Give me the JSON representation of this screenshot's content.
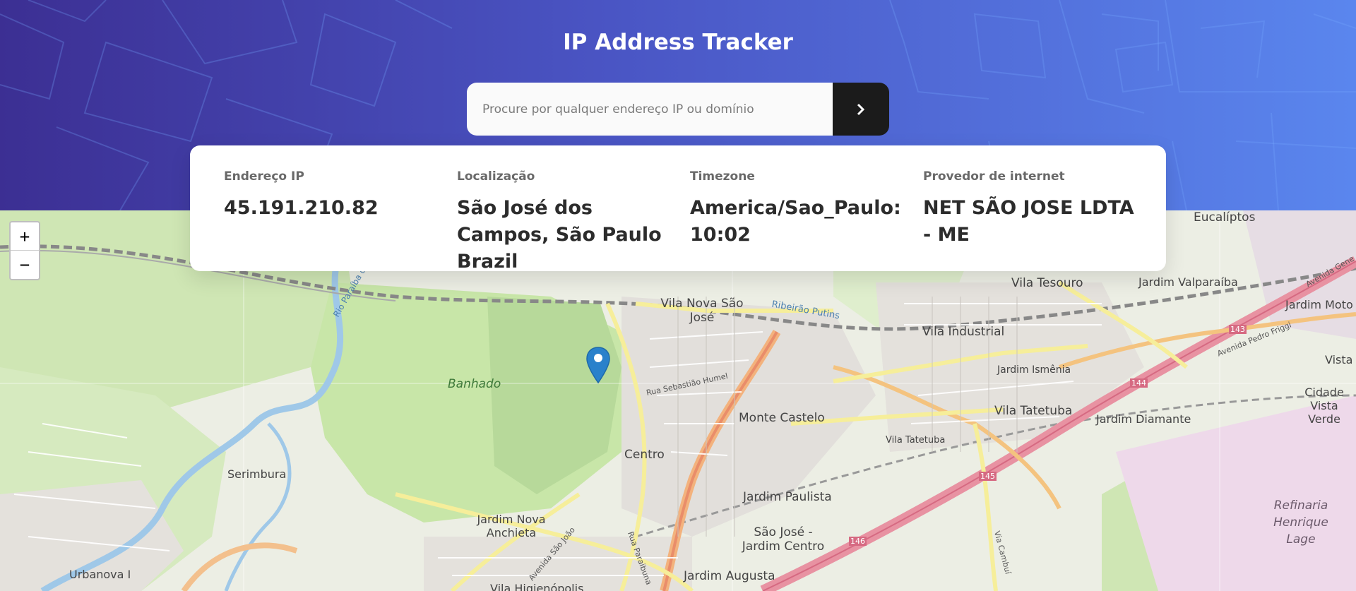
{
  "header": {
    "title": "IP Address Tracker",
    "search_placeholder": "Procure por qualquer endereço IP ou domínio",
    "search_button_icon": "chevron-right-icon"
  },
  "info": {
    "ip": {
      "label": "Endereço IP",
      "value": "45.191.210.82"
    },
    "location": {
      "label": "Localização",
      "value": "São José dos Campos, São Paulo Brazil"
    },
    "timezone": {
      "label": "Timezone",
      "value": "America/Sao_Paulo: 10:02"
    },
    "isp": {
      "label": "Provedor de internet",
      "value": "NET SÃO JOSE LDTA - ME"
    }
  },
  "map": {
    "zoom_in": "+",
    "zoom_out": "−",
    "marker_icon": "location-pin-icon",
    "labels": {
      "eucaliptos": "Eucalíptos",
      "vila_tesouro": "Vila Tesouro",
      "jardim_valparaiba": "Jardim Valparaíba",
      "jardim_moto": "Jardim Moto",
      "vila_nova_sao_jose": "Vila Nova São José",
      "ribeirao": "Ribeirão Putins",
      "vila_industrial": "Vila Industrial",
      "avenida_general": "Avenida Gene",
      "avenida_pedro_friggi": "Avenida Pedro Friggi",
      "vista": "Vista",
      "rio_paraibuna_sul": "Rio Paraíba do Sul",
      "banhado": "Banhado",
      "rua_sebastiao_humel": "Rua Sebastião Humel",
      "jardim_ismenia": "Jardim Ismênia",
      "cidade_vista_verde": "Cidade Vista Verde",
      "monte_castelo": "Monte Castelo",
      "vila_tatetuba": "Vila Tatetuba",
      "vila_tatetuba_small": "Vila Tatetuba",
      "jardim_diamante": "Jardim Diamante",
      "centro": "Centro",
      "serimbura": "Serimbura",
      "jardim_paulista": "Jardim Paulista",
      "refinaria": "Refinaria Henrique Lage",
      "jardim_nova_anchieta": "Jardim Nova Anchieta",
      "sao_jose_jardim_centro": "São José - Jardim Centro",
      "avenida_sao_joao": "Avenida São João",
      "rua_paraibuna": "Rua Paraibuna",
      "via_cambui": "Via Cambuí",
      "urbanova": "Urbanova I",
      "jardim_augusta": "Jardim Augusta",
      "vila_higienopolis": "Vila Higienópolis",
      "road_143": "143",
      "road_144": "144",
      "road_145": "145",
      "road_146": "146"
    }
  },
  "colors": {
    "gradient_start": "#3c2f93",
    "gradient_end": "#5a86ee",
    "button_bg": "#1b1b1b",
    "marker": "#2a81cb"
  }
}
